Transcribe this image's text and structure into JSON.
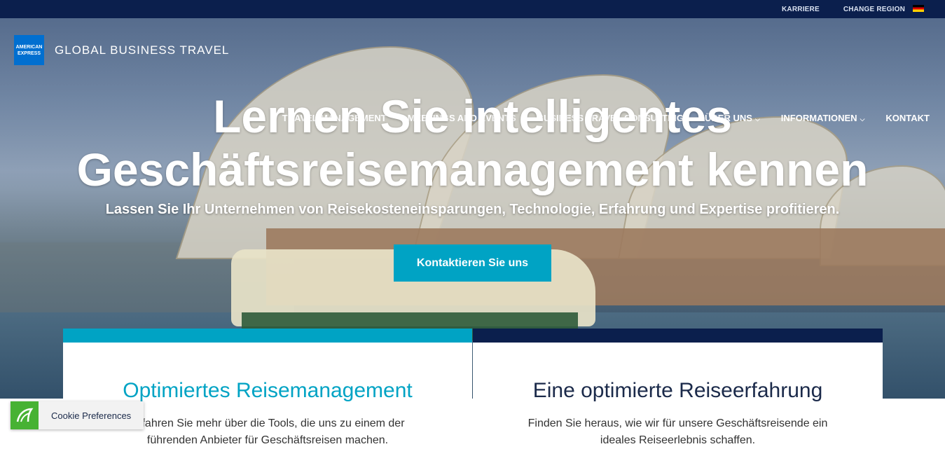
{
  "topbar": {
    "karriere": "KARRIERE",
    "change_region": "CHANGE REGION"
  },
  "brand": {
    "logo_line1": "AMERICAN",
    "logo_line2": "EXPRESS",
    "name": "GLOBAL BUSINESS TRAVEL"
  },
  "nav": {
    "items": [
      {
        "label": "TRAVEL MANAGEMENT"
      },
      {
        "label": "MEETINGS AND EVENTS"
      },
      {
        "label": "BUSINESS TRAVEL CONSULTING"
      },
      {
        "label": "ÜBER UNS"
      },
      {
        "label": "INFORMATIONEN"
      },
      {
        "label": "KONTAKT"
      }
    ]
  },
  "hero": {
    "headline_line1": "Lernen Sie intelligentes",
    "headline_line2": "Geschäftsreisemanagement kennen",
    "subtitle": "Lassen Sie Ihr Unternehmen von Reisekosteneinsparungen, Technologie, Erfahrung und Expertise profitieren.",
    "cta": "Kontaktieren Sie uns"
  },
  "cards": [
    {
      "title": "Optimiertes Reisemanagement",
      "text": "Erfahren Sie mehr über die Tools, die uns zu einem der führenden Anbieter für Geschäftsreisen machen."
    },
    {
      "title": "Eine optimierte Reiseerfahrung",
      "text": "Finden Sie heraus, wie wir für unsere Geschäftsreisende ein ideales Reiseerlebnis schaffen."
    }
  ],
  "cookie": {
    "label": "Cookie Preferences"
  },
  "colors": {
    "navy": "#0b1f4d",
    "teal": "#00a3c4",
    "amex_blue": "#016fd0",
    "cookie_green": "#47b233"
  },
  "icons": {
    "flag": "germany-flag-icon",
    "chevron": "chevron-down-icon",
    "cookie": "cookie-shield-icon"
  }
}
